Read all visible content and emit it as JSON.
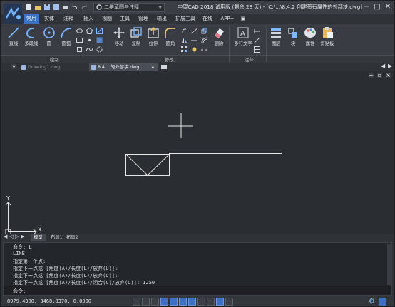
{
  "titlebar": {
    "workspace": "二维草图与注释",
    "title": "中望CAD 2018 试用版 (剩余 28 天) - [C:\\...\\8.4.2 创建带有属性的外部块.dwg]"
  },
  "menu": {
    "tabs": [
      "常用",
      "实体",
      "注释",
      "插入",
      "视图",
      "工具",
      "管理",
      "输出",
      "扩展工具",
      "在线",
      "APP+"
    ]
  },
  "ribbon": {
    "draw": {
      "line": "直线",
      "polyline": "多段线",
      "circle": "圆",
      "arc": "圆弧",
      "panel": "绘制"
    },
    "modify": {
      "move": "移动",
      "copy": "复制",
      "stretch": "拉伸",
      "fillet": "圆角",
      "erase": "删除",
      "panel": "修改"
    },
    "annotation": {
      "mtext": "多行文字",
      "panel": "注释"
    },
    "layer": "图层",
    "block": "块",
    "properties": "属性",
    "clipboard": "剪贴板"
  },
  "doc_tabs": [
    {
      "label": "Drawing1.dwg"
    },
    {
      "label": "8.4....的外部块.dwg"
    }
  ],
  "layout_tabs": [
    "模型",
    "布局1",
    "布局2"
  ],
  "command": {
    "history": [
      "命令: L",
      "LINE",
      "指定第一个点:",
      "指定下一点或 [角度(A)/长度(L)/放弃(U)]:",
      "指定下一点或 [角度(A)/长度(L)/放弃(U)]:",
      "指定下一点或 [角度(A)/长度(L)/闭合(C)/放弃(U)]: 1250"
    ],
    "prompt": "命令:"
  },
  "status": {
    "coordinates": "8979.4300, 3468.8370, 0.0000"
  },
  "ucs": {
    "x_label": "X",
    "y_label": "Y"
  },
  "colors": {
    "accent": "#3e6fc1",
    "canvas": "#2a2d31",
    "geometry": "#e6e6e6"
  }
}
